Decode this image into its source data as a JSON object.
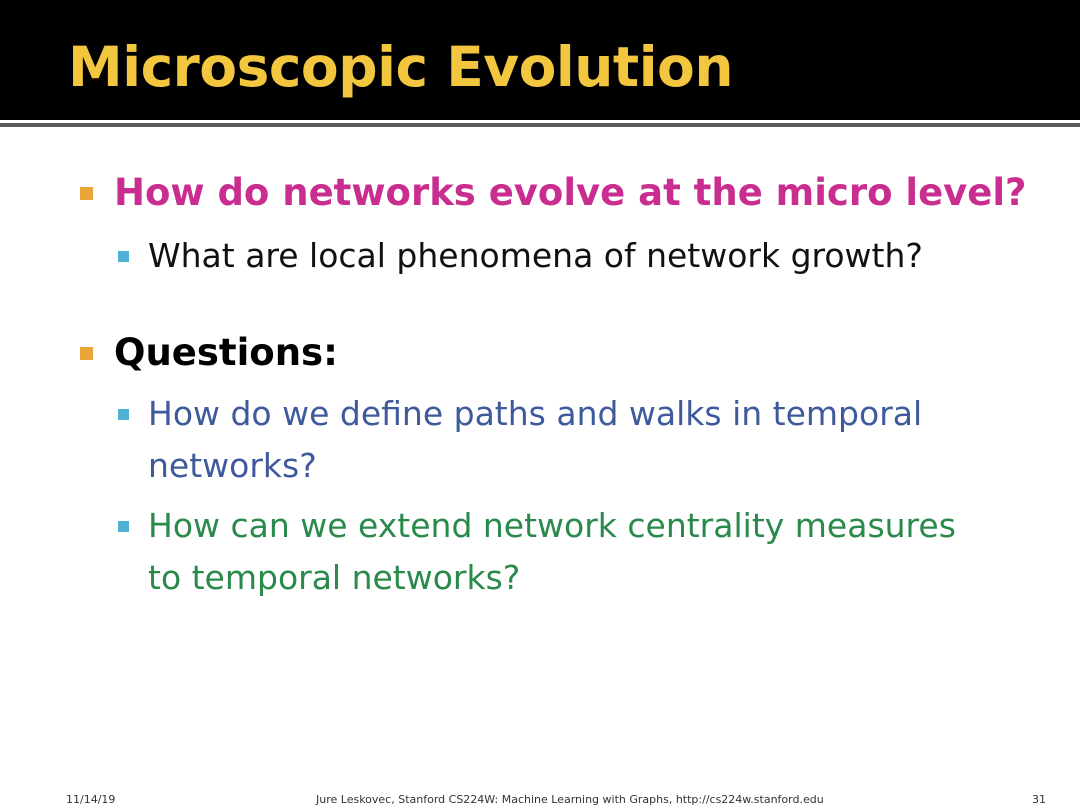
{
  "slide": {
    "title": "Microscopic Evolution"
  },
  "content": {
    "q1": {
      "heading": "How do networks evolve at the micro level?",
      "sub": "What are local phenomena of network growth?"
    },
    "q2": {
      "heading": "Questions:",
      "sub1_line1": "How do we define paths and walks in temporal",
      "sub1_line2": "networks?",
      "sub2_line1": "How can we extend network centrality measures",
      "sub2_line2": "to temporal networks?"
    }
  },
  "footer": {
    "date": "11/14/19",
    "credit": "Jure Leskovec, Stanford CS224W: Machine Learning with Graphs, http://cs224w.stanford.edu",
    "page_number": "31"
  },
  "colors": {
    "title": "#f3c63f",
    "heading_pink": "#c82d8f",
    "sub_blue": "#3f5a9c",
    "sub_green": "#2a8a4c",
    "bullet_orange": "#e8a53a",
    "bullet_cyan": "#4fb1d4"
  }
}
